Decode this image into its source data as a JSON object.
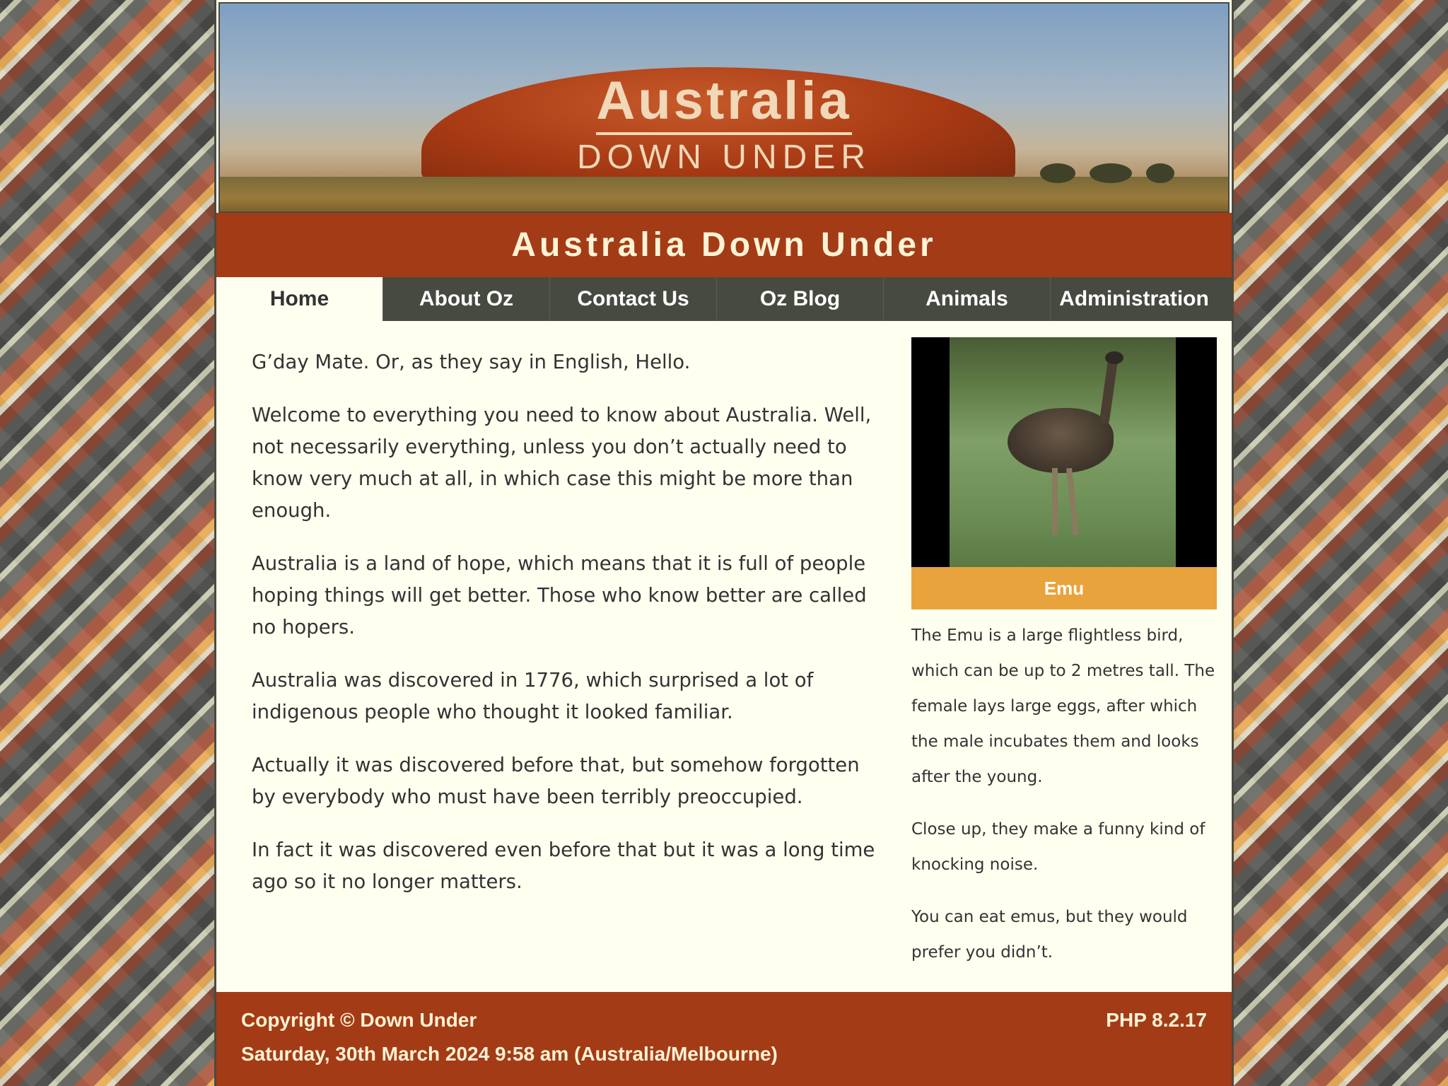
{
  "banner": {
    "brand_title": "Australia",
    "brand_subtitle": "DOWN UNDER"
  },
  "site_title": "Australia Down Under",
  "nav": {
    "items": [
      {
        "label": "Home",
        "active": true
      },
      {
        "label": "About Oz",
        "active": false
      },
      {
        "label": "Contact Us",
        "active": false
      },
      {
        "label": "Oz Blog",
        "active": false
      },
      {
        "label": "Animals",
        "active": false
      },
      {
        "label": "Administration",
        "active": false
      }
    ]
  },
  "main": {
    "paragraphs": [
      "G’day Mate. Or, as they say in English, Hello.",
      "Welcome to everything you need to know about Australia. Well, not necessarily everything, unless you don’t actually need to know very much at all, in which case this might be more than enough.",
      "Australia is a land of hope, which means that it is full of people hoping things will get better. Those who know better are called no hopers.",
      "Australia was discovered in 1776, which surprised a lot of indigenous people who thought it looked familiar.",
      "Actually it was discovered before that, but somehow forgotten by everybody who must have been terribly preoccupied.",
      "In fact it was discovered even before that but it was a long time ago so it no longer matters."
    ]
  },
  "sidebar": {
    "caption": "Emu",
    "paragraphs": [
      "The Emu is a large flightless bird, which can be up to 2 metres tall. The female lays large eggs, after which the male incubates them and looks after the young.",
      "Close up, they make a funny kind of knocking noise.",
      "You can eat emus, but they would prefer you didn’t."
    ]
  },
  "footer": {
    "copyright": "Copyright © Down Under",
    "datetime": "Saturday, 30th March 2024 9:58 am (Australia/Melbourne)",
    "php_version": "PHP 8.2.17"
  },
  "colors": {
    "accent": "#a33c16",
    "nav_bg": "#474a40",
    "caption_bg": "#e8a33c",
    "page_bg": "#fffff0"
  }
}
